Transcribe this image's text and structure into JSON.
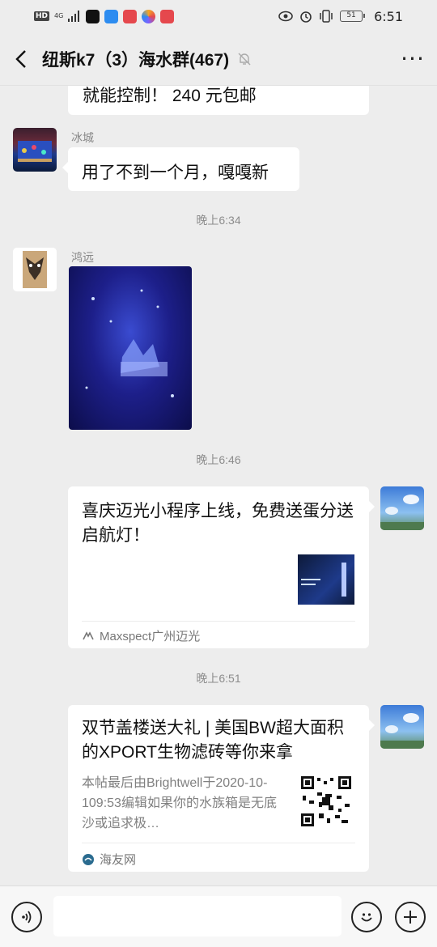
{
  "status_bar": {
    "hd": "HD",
    "network": "4G",
    "time": "6:51",
    "battery": "51"
  },
  "header": {
    "title": "纽斯k7（3）海水群(467)",
    "more": "···"
  },
  "messages": {
    "m0_text": "就能控制！  240 元包邮",
    "m1_sender": "冰城",
    "m1_text": "用了不到一个月，嘎嘎新",
    "t1": "晚上6:34",
    "m2_sender": "鸿远",
    "t2": "晚上6:46",
    "m3_title": "喜庆迈光小程序上线，免费送蛋分送启航灯！",
    "m3_source": "Maxspect广州迈光",
    "t3": "晚上6:51",
    "m4_title": "双节盖楼送大礼 | 美国BW超大面积的XPORT生物滤砖等你来拿",
    "m4_desc": "本帖最后由Brightwell于2020-10-109:53编辑如果你的水族箱是无底沙或追求极…",
    "m4_source": "海友网"
  },
  "colors": {
    "bg": "#ededed",
    "bubble": "#ffffff",
    "muted": "#888888"
  }
}
